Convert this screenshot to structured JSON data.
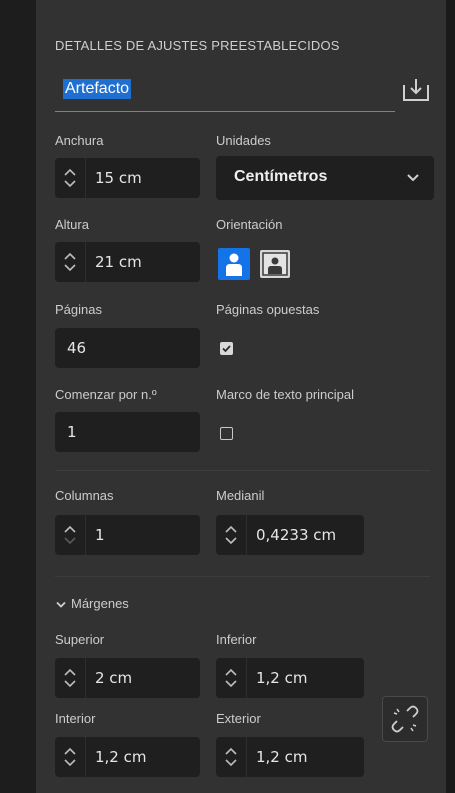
{
  "header": {
    "title": "DETALLES DE AJUSTES PREESTABLECIDOS"
  },
  "preset": {
    "name": "Artefacto"
  },
  "icons": {
    "save": "save-preset-icon",
    "stepper": "stepper-arrows-icon",
    "dropdown": "chevron-down-icon",
    "portrait": "portrait-orientation-icon",
    "landscape": "landscape-orientation-icon",
    "link": "unlink-margins-icon"
  },
  "colors": {
    "accent": "#1f6fd1",
    "panel": "#323232",
    "field": "#1f1f1f"
  },
  "fields": {
    "width": {
      "label": "Anchura",
      "value": "15 cm"
    },
    "units": {
      "label": "Unidades",
      "value": "Centímetros"
    },
    "height": {
      "label": "Altura",
      "value": "21 cm"
    },
    "orientation": {
      "label": "Orientación",
      "selected": "portrait"
    },
    "pages": {
      "label": "Páginas",
      "value": "46"
    },
    "facing_pages": {
      "label": "Páginas opuestas",
      "checked": true
    },
    "start_page": {
      "label": "Comenzar por n.º",
      "value": "1"
    },
    "primary_text_frame": {
      "label": "Marco de texto principal",
      "checked": false
    },
    "columns": {
      "label": "Columnas",
      "value": "1"
    },
    "gutter": {
      "label": "Medianil",
      "value": "0,4233 cm"
    }
  },
  "margins": {
    "heading": "Márgenes",
    "top": {
      "label": "Superior",
      "value": "2 cm"
    },
    "bottom": {
      "label": "Inferior",
      "value": "1,2 cm"
    },
    "inside": {
      "label": "Interior",
      "value": "1,2 cm"
    },
    "outside": {
      "label": "Exterior",
      "value": "1,2 cm"
    }
  }
}
